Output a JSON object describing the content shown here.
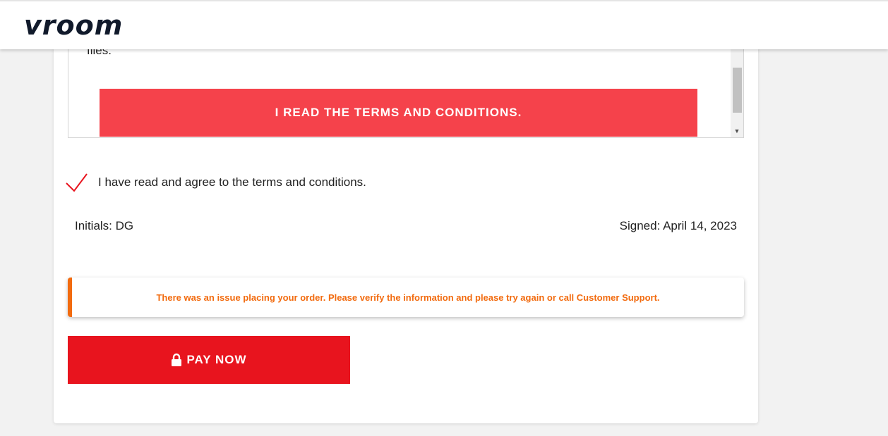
{
  "header": {
    "logo_text": "vroom"
  },
  "terms": {
    "partial_text": "files.",
    "read_button_label": "I READ THE TERMS AND CONDITIONS."
  },
  "agreement": {
    "checked": true,
    "label": "I have read and agree to the terms and conditions."
  },
  "signature": {
    "initials": "Initials: DG",
    "signed": "Signed: April 14, 2023"
  },
  "alert": {
    "message": "There was an issue placing your order. Please verify the information and please try again or call Customer Support."
  },
  "pay": {
    "label": "PAY NOW",
    "icon": "lock-icon"
  },
  "colors": {
    "terms_button": "#f5424b",
    "pay_button": "#e8141e",
    "alert_accent": "#f26b0f",
    "check": "#e8141e",
    "logo": "#111a2b"
  }
}
